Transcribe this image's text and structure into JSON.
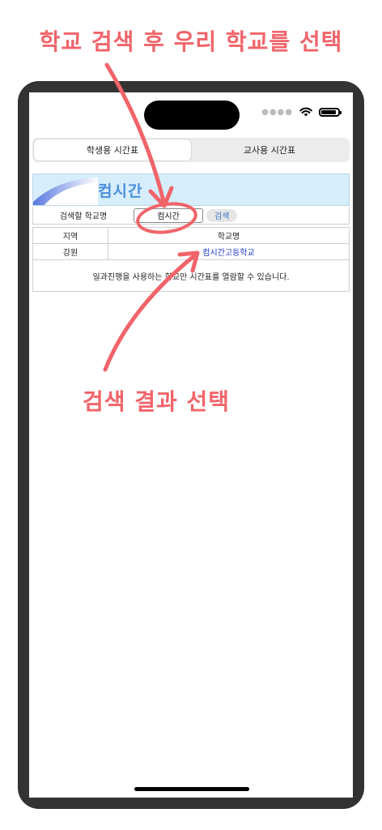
{
  "annotations": {
    "top": "학교 검색 후 우리 학교를 선택",
    "middle": "검색 결과 선택"
  },
  "colors": {
    "annotation": "#f0646a",
    "banner_bg": "#d6eefb",
    "logo": "#4b8fdd",
    "link": "#1a35c8"
  },
  "tabs": [
    {
      "label": "학생용 시간표",
      "active": true
    },
    {
      "label": "교사용 시간표",
      "active": false
    }
  ],
  "banner": {
    "logo_text": "컴시간"
  },
  "search": {
    "label": "검색할 학교명",
    "input_value": "컴시간",
    "button_label": "검색"
  },
  "results": {
    "headers": [
      "지역",
      "학교명"
    ],
    "rows": [
      {
        "region": "강원",
        "school": "컴시간고등학교"
      }
    ],
    "note": "일과진행을 사용하는 학교만 시간표를 열람할 수 있습니다."
  }
}
